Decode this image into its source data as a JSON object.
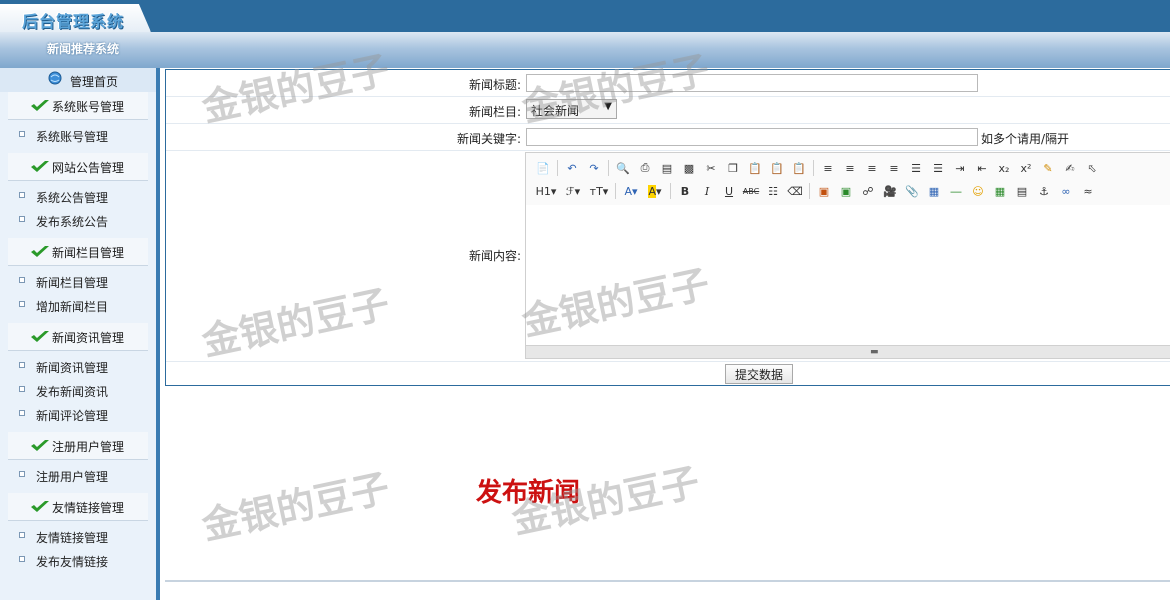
{
  "app": {
    "logo_text": "后台管理系统",
    "system_title": "新闻推荐系统"
  },
  "sidebar": {
    "home_label": "管理首页",
    "groups": [
      {
        "label": "系统账号管理",
        "items": [
          "系统账号管理"
        ]
      },
      {
        "label": "网站公告管理",
        "items": [
          "系统公告管理",
          "发布系统公告"
        ]
      },
      {
        "label": "新闻栏目管理",
        "items": [
          "新闻栏目管理",
          "增加新闻栏目"
        ]
      },
      {
        "label": "新闻资讯管理",
        "items": [
          "新闻资讯管理",
          "发布新闻资讯",
          "新闻评论管理"
        ]
      },
      {
        "label": "注册用户管理",
        "items": [
          "注册用户管理"
        ]
      },
      {
        "label": "友情链接管理",
        "items": [
          "友情链接管理",
          "发布友情链接"
        ]
      }
    ]
  },
  "form": {
    "title_label": "新闻标题:",
    "title_value": "",
    "column_label": "新闻栏目:",
    "column_selected": "社会新闻",
    "keywords_label": "新闻关键字:",
    "keywords_value": "",
    "keywords_hint": "如多个请用/隔开",
    "content_label": "新闻内容:",
    "submit_label": "提交数据"
  },
  "editor": {
    "heading_label": "H1",
    "font_label": "ℱ",
    "size_label": "ᴛT",
    "text_color_label": "A",
    "highlight_label": "A",
    "bold_label": "B",
    "italic_label": "I",
    "underline_label": "U",
    "strike_label": "ABC",
    "toolbar_row1_icons": [
      "source-icon",
      "undo-icon",
      "redo-icon",
      "preview-icon",
      "print-icon",
      "template-icon",
      "cut-icon",
      "copy-icon",
      "paste-icon",
      "paste-text-icon",
      "paste-word-icon",
      "align-left-icon",
      "align-center-icon",
      "align-right-icon",
      "align-justify-icon",
      "ordered-list-icon",
      "unordered-list-icon",
      "indent-icon",
      "outdent-icon",
      "subscript-icon",
      "superscript-icon",
      "clear-format-icon",
      "select-all-icon",
      "pointer-icon"
    ],
    "toolbar_row2_icons": [
      "heading-icon",
      "font-family-icon",
      "font-size-icon",
      "text-color-icon",
      "highlight-icon",
      "bold-icon",
      "italic-icon",
      "underline-icon",
      "strikethrough-icon",
      "line-height-icon",
      "eraser-icon",
      "image-icon",
      "multi-image-icon",
      "flash-icon",
      "media-icon",
      "attachment-icon",
      "table-icon",
      "hr-icon",
      "emoticon-icon",
      "map-icon",
      "pagebreak-icon",
      "anchor-icon",
      "link-icon",
      "unlink-icon"
    ],
    "accent_color": "#2c6b9d"
  },
  "page": {
    "caption": "发布新闻",
    "watermark": "金银的豆子"
  },
  "colors": {
    "topbar": "#2c6b9d",
    "caption": "#cc1111",
    "sidebar_bg": "#eaf2fa"
  }
}
